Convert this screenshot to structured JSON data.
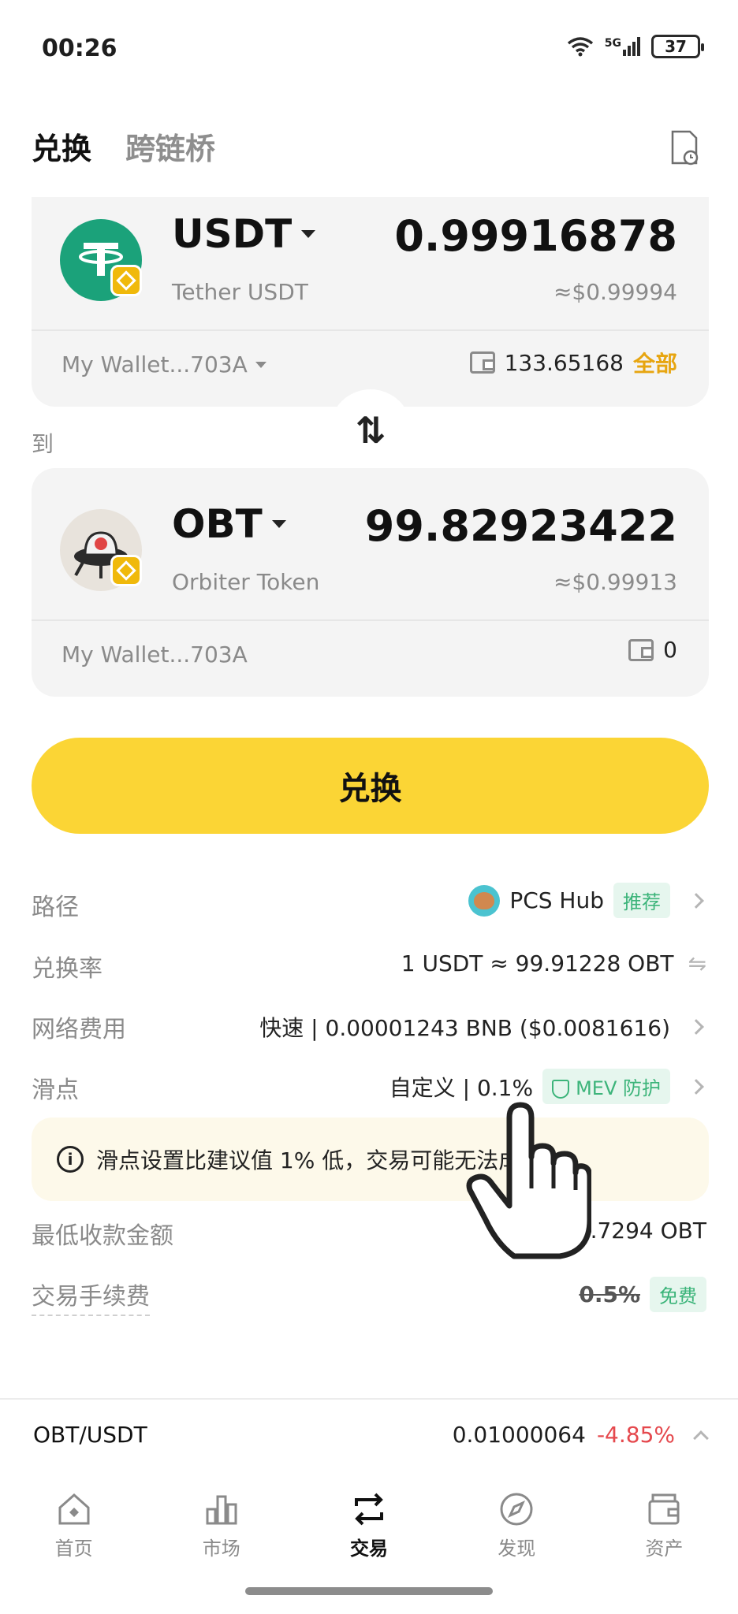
{
  "status_bar": {
    "time": "00:26",
    "network": "5G",
    "battery": "37"
  },
  "tabs": [
    {
      "label": "兑换",
      "active": true
    },
    {
      "label": "跨链桥",
      "active": false
    }
  ],
  "from_token": {
    "symbol": "USDT",
    "name": "Tether USDT",
    "amount": "0.99916878",
    "usd_value": "≈$0.99994",
    "wallet": "My Wallet...703A",
    "balance": "133.65168",
    "max_label": "全部",
    "logo_color": "#1ba27a"
  },
  "to_label": "到",
  "switch_icon": "⇅",
  "to_token": {
    "symbol": "OBT",
    "name": "Orbiter Token",
    "amount": "99.82923422",
    "usd_value": "≈$0.99913",
    "wallet": "My Wallet...703A",
    "balance": "0"
  },
  "swap_button": "兑换",
  "details": {
    "route": {
      "label": "路径",
      "value": "PCS Hub",
      "tag": "推荐"
    },
    "rate": {
      "label": "兑换率",
      "value": "1 USDT ≈ 99.91228 OBT"
    },
    "network_fee": {
      "label": "网络费用",
      "value": "快速 | 0.00001243 BNB ($0.0081616)"
    },
    "slippage": {
      "label": "滑点",
      "value": "自定义 | 0.1%",
      "tag": "MEV 防护"
    },
    "warning": "滑点设置比建议值 1% 低，交易可能无法成功",
    "min_received": {
      "label": "最低收款金额",
      "value": "99.7294 OBT"
    },
    "trading_fee": {
      "label": "交易手续费",
      "original": "0.5%",
      "tag": "免费"
    }
  },
  "pair_bar": {
    "pair": "OBT/USDT",
    "price": "0.01000064",
    "change": "-4.85%"
  },
  "nav": [
    {
      "label": "首页",
      "icon": "home-icon",
      "active": false
    },
    {
      "label": "市场",
      "icon": "market-icon",
      "active": false
    },
    {
      "label": "交易",
      "icon": "trade-icon",
      "active": true
    },
    {
      "label": "发现",
      "icon": "discover-icon",
      "active": false
    },
    {
      "label": "资产",
      "icon": "assets-icon",
      "active": false
    }
  ],
  "colors": {
    "accent": "#fbd535",
    "max_link": "#e7a510",
    "negative": "#e5484d",
    "positive_tag": "#3cb47a"
  }
}
